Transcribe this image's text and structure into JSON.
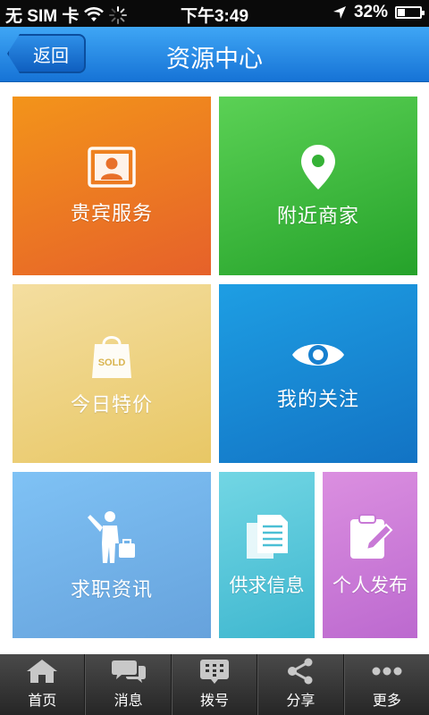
{
  "status_bar": {
    "carrier": "无 SIM 卡",
    "time": "下午3:49",
    "battery": "32%",
    "battery_level": 0.32
  },
  "header": {
    "back_label": "返回",
    "title": "资源中心"
  },
  "tiles": {
    "vip": {
      "label": "贵宾服务",
      "icon": "vip-card-icon"
    },
    "nearby": {
      "label": "附近商家",
      "icon": "location-pin-icon"
    },
    "deals": {
      "label": "今日特价",
      "icon": "sold-bag-icon",
      "badge": "SOLD"
    },
    "follow": {
      "label": "我的关注",
      "icon": "eye-icon"
    },
    "jobs": {
      "label": "求职资讯",
      "icon": "job-seeker-icon"
    },
    "supply": {
      "label": "供求信息",
      "icon": "documents-icon"
    },
    "post": {
      "label": "个人发布",
      "icon": "clipboard-edit-icon"
    }
  },
  "colors": {
    "header": "#1f86e2",
    "vip": "#ec7a22",
    "nearby": "#3cb93d",
    "deals": "#eed27f",
    "follow": "#1788d3",
    "jobs": "#72b1e8",
    "supply": "#56c6da",
    "post": "#cc7cd8"
  },
  "tabbar": [
    {
      "label": "首页",
      "icon": "home-icon"
    },
    {
      "label": "消息",
      "icon": "chat-icon"
    },
    {
      "label": "拨号",
      "icon": "dialpad-icon"
    },
    {
      "label": "分享",
      "icon": "share-icon"
    },
    {
      "label": "更多",
      "icon": "more-icon"
    }
  ]
}
